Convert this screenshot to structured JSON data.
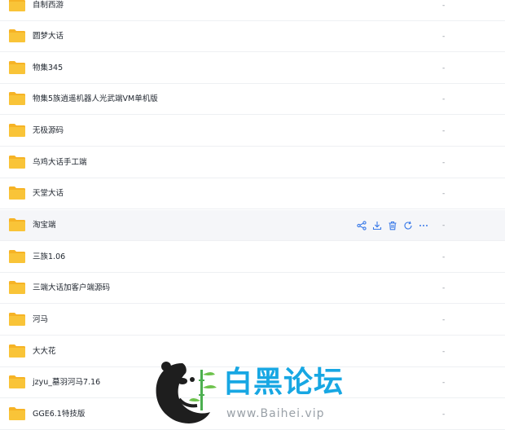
{
  "colors": {
    "folder_body": "#f9c438",
    "folder_tab": "#f6b325",
    "action_blue": "#3a7ae8",
    "row_hover": "#f5f6f9",
    "watermark_blue": "#17a7e3"
  },
  "files": [
    {
      "name": "自制西游",
      "size": "-"
    },
    {
      "name": "圆梦大话",
      "size": "-"
    },
    {
      "name": "物集345",
      "size": "-"
    },
    {
      "name": "物集5族逍遥机器人光武端VM单机版",
      "size": "-"
    },
    {
      "name": "无极源码",
      "size": "-"
    },
    {
      "name": "乌鸡大话手工端",
      "size": "-"
    },
    {
      "name": "天堂大话",
      "size": "-"
    },
    {
      "name": "淘宝端",
      "size": "-"
    },
    {
      "name": "三族1.06",
      "size": "-"
    },
    {
      "name": "三端大话加客户端源码",
      "size": "-"
    },
    {
      "name": "河马",
      "size": "-"
    },
    {
      "name": "大大花",
      "size": "-"
    },
    {
      "name": "jzyu_墓羽河马7.16",
      "size": "-"
    },
    {
      "name": "GGE6.1特技版",
      "size": "-"
    }
  ],
  "hover_actions": [
    "share-icon",
    "download-icon",
    "delete-icon",
    "refresh-icon",
    "more-icon"
  ],
  "watermark": {
    "title": "白黑论坛",
    "url": "www.Baihei.vip"
  }
}
